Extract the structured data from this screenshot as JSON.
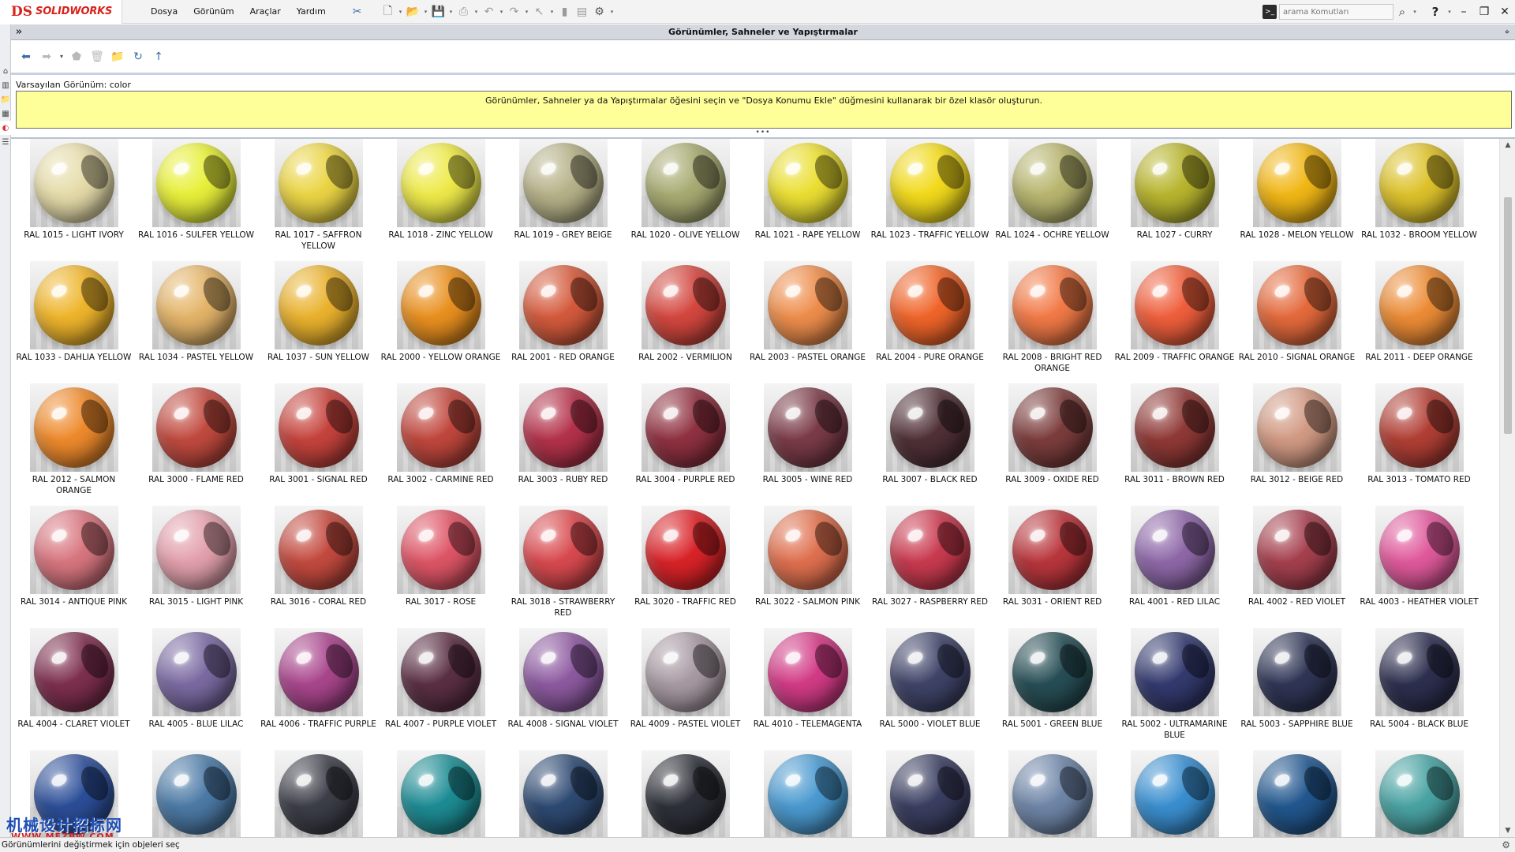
{
  "app": {
    "logo_ds": "DS",
    "logo_text": "SOLIDWORKS",
    "menu": [
      "Dosya",
      "Görünüm",
      "Araçlar",
      "Yardım"
    ],
    "search_placeholder": "arama Komutları",
    "search_cmd_icon": "terminal-icon"
  },
  "task_pane": {
    "title": "Görünümler, Sahneler ve Yapıştırmalar",
    "default_appearance": "Varsayılan Görünüm: color",
    "banner_text": "Görünümler, Sahneler ya da Yapıştırmalar öğesini seçin ve \"Dosya Konumu Ekle\" düğmesini kullanarak bir özel klasör oluşturun."
  },
  "status_bar": {
    "text": "Görünümlerini değiştirmek için objeleri seç"
  },
  "watermark": {
    "text": "机械设计招标网",
    "url": "WWW.MEZBW.COM"
  },
  "swatches": [
    {
      "label": "RAL 1015 - LIGHT IVORY",
      "color": "#e6dcaa"
    },
    {
      "label": "RAL 1016 - SULFER YELLOW",
      "color": "#e8f03a"
    },
    {
      "label": "RAL 1017 - SAFFRON YELLOW",
      "color": "#ebd545"
    },
    {
      "label": "RAL 1018 - ZINC YELLOW",
      "color": "#eeea4a"
    },
    {
      "label": "RAL 1019 - GREY BEIGE",
      "color": "#b6b289"
    },
    {
      "label": "RAL 1020 - OLIVE YELLOW",
      "color": "#a8ab72"
    },
    {
      "label": "RAL 1021 - RAPE YELLOW",
      "color": "#ebdf33"
    },
    {
      "label": "RAL 1023 - TRAFFIC YELLOW",
      "color": "#f2da1c"
    },
    {
      "label": "RAL 1024 - OCHRE YELLOW",
      "color": "#b8b66f"
    },
    {
      "label": "RAL 1027 - CURRY",
      "color": "#b8b52e"
    },
    {
      "label": "RAL 1028 - MELON YELLOW",
      "color": "#f1b716"
    },
    {
      "label": "RAL 1032 - BROOM YELLOW",
      "color": "#ddc22b"
    },
    {
      "label": "RAL 1033 - DAHLIA YELLOW",
      "color": "#efb52c"
    },
    {
      "label": "RAL 1034 - PASTEL YELLOW",
      "color": "#e4b56a"
    },
    {
      "label": "RAL 1037 - SUN YELLOW",
      "color": "#eab22e"
    },
    {
      "label": "RAL 2000 - YELLOW ORANGE",
      "color": "#e9901f"
    },
    {
      "label": "RAL 2001 - RED ORANGE",
      "color": "#d45a3c"
    },
    {
      "label": "RAL 2002 - VERMILION",
      "color": "#d3473f"
    },
    {
      "label": "RAL 2003 - PASTEL ORANGE",
      "color": "#ee8e4c"
    },
    {
      "label": "RAL 2004 - PURE ORANGE",
      "color": "#f0652a"
    },
    {
      "label": "RAL 2008 - BRIGHT RED ORANGE",
      "color": "#f27a47"
    },
    {
      "label": "RAL 2009 - TRAFFIC ORANGE",
      "color": "#ef5f3c"
    },
    {
      "label": "RAL 2010 - SIGNAL ORANGE",
      "color": "#e46a3c"
    },
    {
      "label": "RAL 2011 - DEEP ORANGE",
      "color": "#ec8c36"
    },
    {
      "label": "RAL 2012 - SALMON ORANGE",
      "color": "#ee8a2c"
    },
    {
      "label": "RAL 3000 - FLAME RED",
      "color": "#c14a3f"
    },
    {
      "label": "RAL 3001 - SIGNAL RED",
      "color": "#c6433c"
    },
    {
      "label": "RAL 3002 - CARMINE RED",
      "color": "#c0473d"
    },
    {
      "label": "RAL 3003 - RUBY RED",
      "color": "#b3324a"
    },
    {
      "label": "RAL 3004 - PURPLE RED",
      "color": "#8f3140"
    },
    {
      "label": "RAL 3005 - WINE RED",
      "color": "#7a3b48"
    },
    {
      "label": "RAL 3007 - BLACK RED",
      "color": "#4f3036"
    },
    {
      "label": "RAL 3009 - OXIDE RED",
      "color": "#7b3d3c"
    },
    {
      "label": "RAL 3011 - BROWN RED",
      "color": "#8f3936"
    },
    {
      "label": "RAL 3012 - BEIGE RED",
      "color": "#d29a84"
    },
    {
      "label": "RAL 3013 - TOMATO RED",
      "color": "#b13f35"
    },
    {
      "label": "RAL 3014 - ANTIQUE PINK",
      "color": "#d8767f"
    },
    {
      "label": "RAL 3015 - LIGHT PINK",
      "color": "#e3a1ad"
    },
    {
      "label": "RAL 3016 - CORAL RED",
      "color": "#c34a3f"
    },
    {
      "label": "RAL 3017 - ROSE",
      "color": "#de5566"
    },
    {
      "label": "RAL 3018 - STRAWBERRY RED",
      "color": "#d84a4f"
    },
    {
      "label": "RAL 3020 - TRAFFIC RED",
      "color": "#d92328"
    },
    {
      "label": "RAL 3022 - SALMON PINK",
      "color": "#df704f"
    },
    {
      "label": "RAL 3027 - RASPBERRY RED",
      "color": "#c93a4f"
    },
    {
      "label": "RAL 3031 - ORIENT RED",
      "color": "#b8363c"
    },
    {
      "label": "RAL 4001 - RED LILAC",
      "color": "#8e68a8"
    },
    {
      "label": "RAL 4002 - RED VIOLET",
      "color": "#a5404e"
    },
    {
      "label": "RAL 4003 - HEATHER VIOLET",
      "color": "#e05a9c"
    },
    {
      "label": "RAL 4004 - CLARET VIOLET",
      "color": "#7d2f4e"
    },
    {
      "label": "RAL 4005 - BLUE LILAC",
      "color": "#7b6aa2"
    },
    {
      "label": "RAL 4006 - TRAFFIC PURPLE",
      "color": "#a9468d"
    },
    {
      "label": "RAL 4007 - PURPLE VIOLET",
      "color": "#5a2f44"
    },
    {
      "label": "RAL 4008 - SIGNAL VIOLET",
      "color": "#8d5aa0"
    },
    {
      "label": "RAL 4009 - PASTEL VIOLET",
      "color": "#a89aa3"
    },
    {
      "label": "RAL 4010 - TELEMAGENTA",
      "color": "#d23b86"
    },
    {
      "label": "RAL 5000 - VIOLET BLUE",
      "color": "#3f4468"
    },
    {
      "label": "RAL 5001 - GREEN BLUE",
      "color": "#274e55"
    },
    {
      "label": "RAL 5002 - ULTRAMARINE BLUE",
      "color": "#333a6e"
    },
    {
      "label": "RAL 5003 - SAPPHIRE BLUE",
      "color": "#2f3555"
    },
    {
      "label": "RAL 5004 - BLACK BLUE",
      "color": "#2d2f4f"
    },
    {
      "label": "",
      "color": "#2c4e98"
    },
    {
      "label": "",
      "color": "#4c7aa6"
    },
    {
      "label": "",
      "color": "#3c3e48"
    },
    {
      "label": "",
      "color": "#1d8c94"
    },
    {
      "label": "",
      "color": "#2e4a72"
    },
    {
      "label": "",
      "color": "#2d3038"
    },
    {
      "label": "",
      "color": "#4b9ad0"
    },
    {
      "label": "",
      "color": "#3a3e60"
    },
    {
      "label": "",
      "color": "#6f86a8"
    },
    {
      "label": "",
      "color": "#3a8fd0"
    },
    {
      "label": "",
      "color": "#22578e"
    },
    {
      "label": "",
      "color": "#4aa3a3"
    }
  ]
}
